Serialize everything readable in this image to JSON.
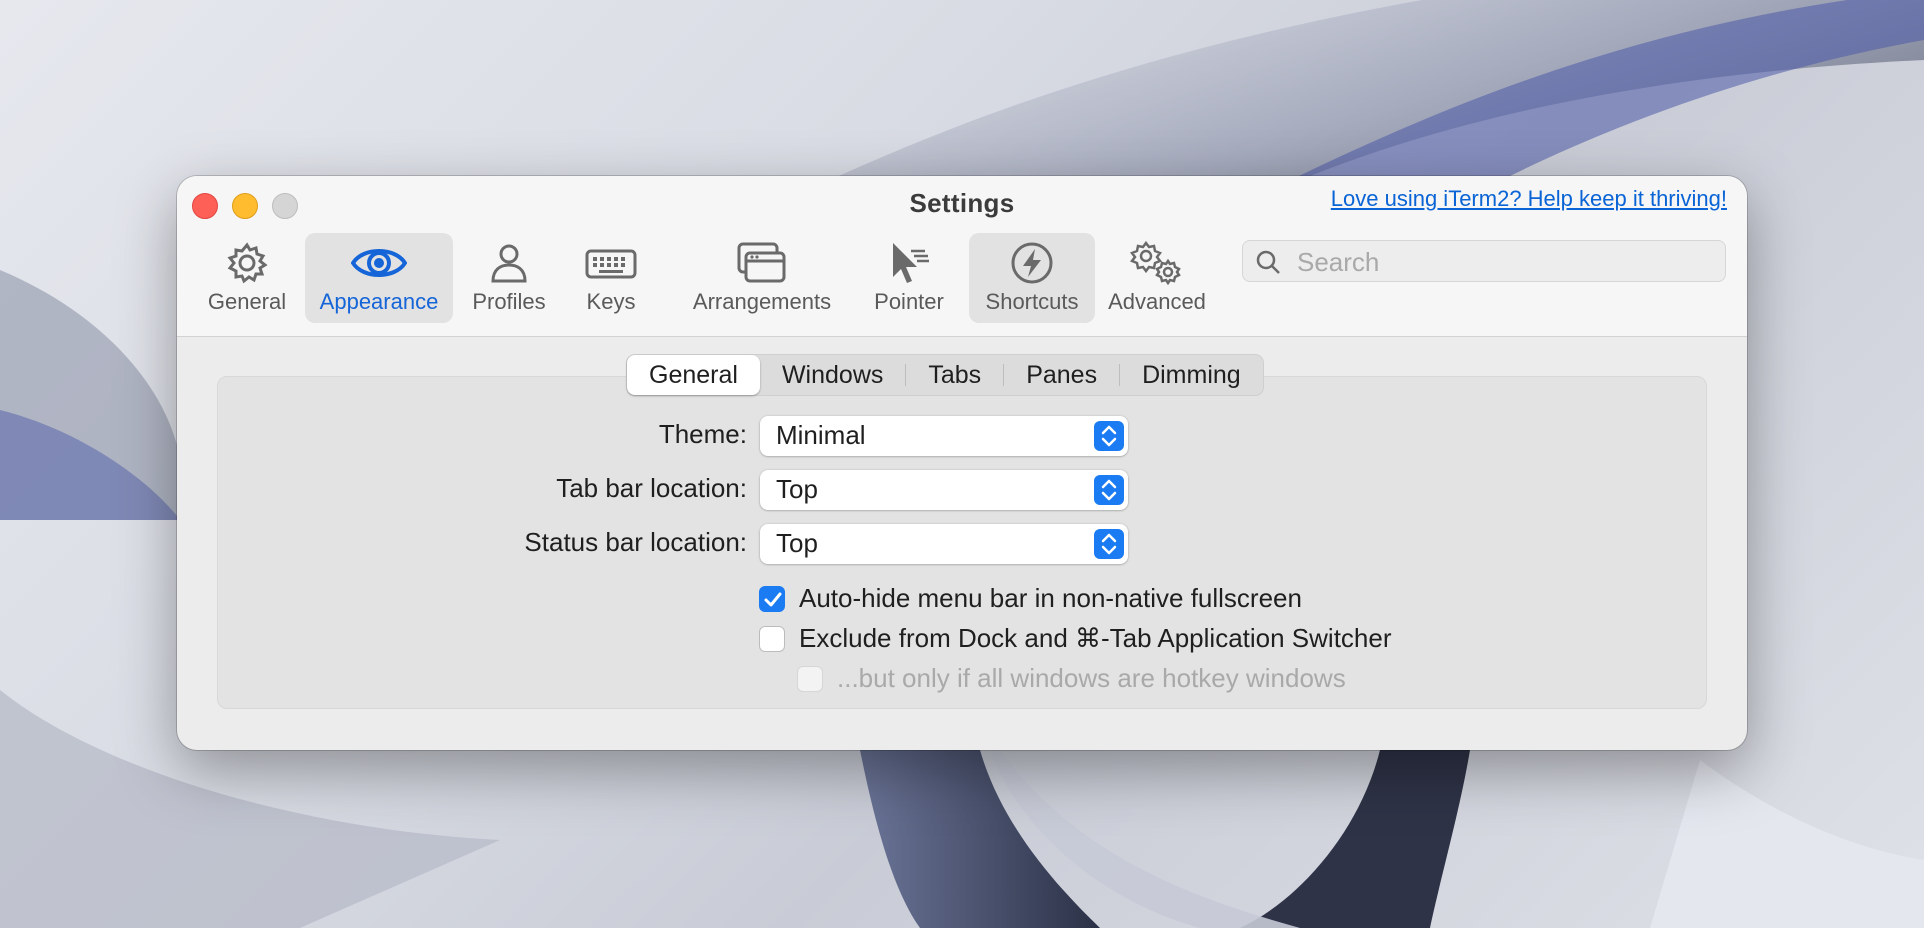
{
  "window": {
    "title": "Settings",
    "donate_link": "Love using iTerm2? Help keep it thriving!"
  },
  "toolbar": {
    "items": [
      {
        "label": "General",
        "icon": "gear-icon"
      },
      {
        "label": "Appearance",
        "icon": "eye-icon"
      },
      {
        "label": "Profiles",
        "icon": "person-icon"
      },
      {
        "label": "Keys",
        "icon": "keyboard-icon"
      },
      {
        "label": "Arrangements",
        "icon": "windows-icon"
      },
      {
        "label": "Pointer",
        "icon": "pointer-icon"
      },
      {
        "label": "Shortcuts",
        "icon": "bolt-icon"
      },
      {
        "label": "Advanced",
        "icon": "gears-icon"
      }
    ],
    "active": "Appearance",
    "search_placeholder": "Search"
  },
  "tabs": {
    "items": [
      "General",
      "Windows",
      "Tabs",
      "Panes",
      "Dimming"
    ],
    "selected": "General"
  },
  "form": {
    "theme_label": "Theme:",
    "theme_value": "Minimal",
    "tab_bar_label": "Tab bar location:",
    "tab_bar_value": "Top",
    "status_bar_label": "Status bar location:",
    "status_bar_value": "Top",
    "autohide_label": "Auto-hide menu bar in non-native fullscreen",
    "autohide_checked": true,
    "exclude_label": "Exclude from Dock and ⌘-Tab Application Switcher",
    "exclude_checked": false,
    "hotkey_label": "...but only if all windows are hotkey windows",
    "hotkey_checked": false,
    "hotkey_enabled": false
  },
  "colors": {
    "accent": "#1a7bf2",
    "link": "#0a64d6",
    "close": "#fe5f57",
    "minimize": "#febc2e",
    "maximize": "#d5d5d5"
  }
}
